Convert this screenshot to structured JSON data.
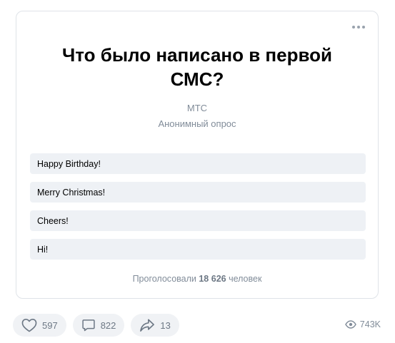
{
  "poll": {
    "title": "Что было написано в первой СМС?",
    "author": "МТС",
    "type": "Анонимный опрос",
    "options": [
      {
        "label": "Happy Birthday!"
      },
      {
        "label": "Merry Christmas!"
      },
      {
        "label": "Cheers!"
      },
      {
        "label": "Hi!"
      }
    ],
    "votes_prefix": "Проголосовали",
    "votes_count": "18 626",
    "votes_suffix": "человек",
    "more_icon": "more-horizontal-icon"
  },
  "actions": {
    "likes": "597",
    "comments": "822",
    "shares": "13",
    "views": "743K",
    "like_icon": "heart-icon",
    "comment_icon": "comment-icon",
    "share_icon": "share-icon",
    "views_icon": "eye-icon"
  },
  "colors": {
    "option_bg": "#eef1f5",
    "secondary_text": "#818c99",
    "pill_bg": "#f0f2f5",
    "border": "#dfe3e8"
  }
}
